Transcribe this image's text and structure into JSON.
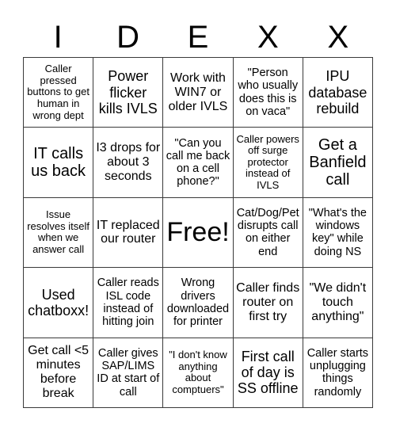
{
  "title_letters": [
    "I",
    "D",
    "E",
    "X",
    "X"
  ],
  "cells": [
    [
      "Caller pressed buttons to get human in wrong dept",
      "Power flicker kills IVLS",
      "Work with WIN7 or older IVLS",
      "\"Person who usually does this is on vaca\"",
      "IPU database rebuild"
    ],
    [
      "IT calls us back",
      "I3 drops for about 3 seconds",
      "\"Can you call me back on a cell phone?\"",
      "Caller powers off surge protector instead of IVLS",
      "Get a Banfield call"
    ],
    [
      "Issue resolves itself when we answer call",
      "IT replaced our router",
      "Free!",
      "Cat/Dog/Pet disrupts call on either end",
      "\"What's the windows key\" while doing NS"
    ],
    [
      "Used chatboxx!",
      "Caller reads ISL code instead of hitting join",
      "Wrong drivers downloaded for printer",
      "Caller finds router on first try",
      "\"We didn't touch anything\""
    ],
    [
      "Get call <5 minutes before break",
      "Caller gives SAP/LIMS ID at start of call",
      "\"I don't know anything about comptuers\"",
      "First call of day is SS offline",
      "Caller starts unplugging things randomly"
    ]
  ],
  "free_space": {
    "row": 2,
    "col": 2
  }
}
